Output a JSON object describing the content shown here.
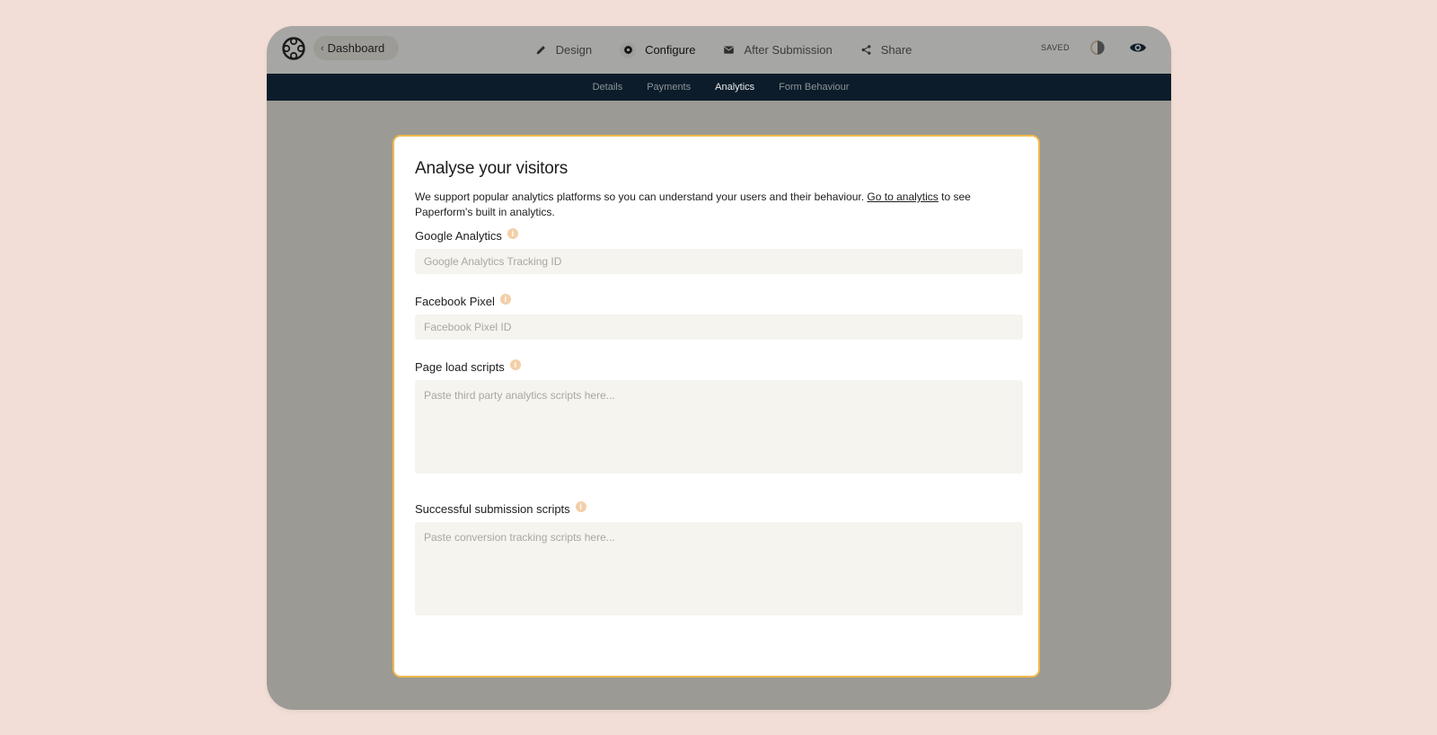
{
  "header": {
    "dashboard_label": "Dashboard",
    "nav": [
      {
        "label": "Design",
        "icon": "pencil-icon"
      },
      {
        "label": "Configure",
        "icon": "gear-icon"
      },
      {
        "label": "After Submission",
        "icon": "envelope-icon"
      },
      {
        "label": "Share",
        "icon": "share-icon"
      }
    ],
    "active_nav": "Configure",
    "saved_status": "SAVED"
  },
  "subnav": {
    "items": [
      "Details",
      "Payments",
      "Analytics",
      "Form Behaviour"
    ],
    "active": "Analytics"
  },
  "card": {
    "title": "Analyse your visitors",
    "description_before": "We support popular analytics platforms so you can understand your users and their behaviour. ",
    "description_link": "Go to analytics",
    "description_after": " to see Paperform's built in analytics.",
    "fields": [
      {
        "label": "Google Analytics",
        "placeholder": "Google Analytics Tracking ID",
        "value": ""
      },
      {
        "label": "Facebook Pixel",
        "placeholder": "Facebook Pixel ID",
        "value": ""
      },
      {
        "label": "Page load scripts",
        "placeholder": "Paste third party analytics scripts here...",
        "value": ""
      },
      {
        "label": "Successful submission scripts",
        "placeholder": "Paste conversion tracking scripts here...",
        "value": ""
      }
    ]
  },
  "colors": {
    "page_background": "#f2ded6",
    "top_bar": "#a6a6a4",
    "subnav_background": "#0c1c2a",
    "card_border": "#f0b84a",
    "info_icon": "#f3cfa9",
    "input_background": "#f5f4ef"
  }
}
